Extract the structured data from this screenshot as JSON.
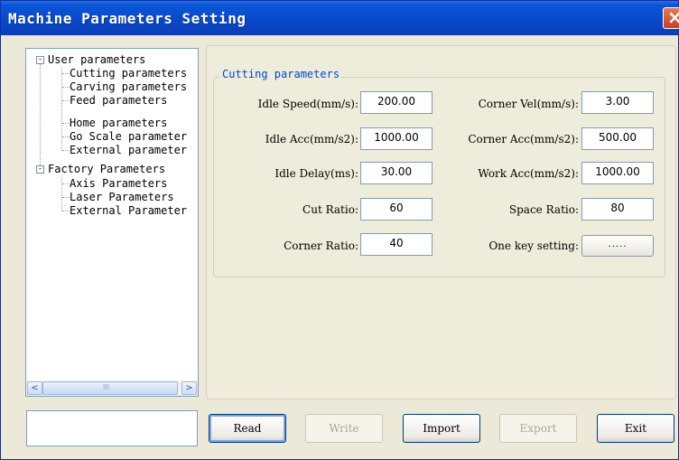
{
  "window": {
    "title": "Machine Parameters Setting"
  },
  "close_icon": "×",
  "tree": {
    "groups": [
      {
        "label": "User parameters",
        "children": [
          "Cutting parameters",
          "Carving parameters",
          "Feed parameters",
          "Home parameters",
          "Go Scale parameter",
          "External parameter"
        ]
      },
      {
        "label": "Factory Parameters",
        "children": [
          "Axis Parameters",
          "Laser Parameters",
          "External Parameter"
        ]
      }
    ]
  },
  "scrollbar": {
    "left_icon": "<",
    "right_icon": ">",
    "grip": "III"
  },
  "cutting": {
    "title": "Cutting parameters",
    "idle_speed": {
      "label": "Idle Speed(mm/s):",
      "value": "200.00"
    },
    "idle_acc": {
      "label": "Idle Acc(mm/s2):",
      "value": "1000.00"
    },
    "idle_delay": {
      "label": "Idle Delay(ms):",
      "value": "30.00"
    },
    "cut_ratio": {
      "label": "Cut Ratio:",
      "value": "60"
    },
    "corner_ratio": {
      "label": "Corner Ratio:",
      "value": "40"
    },
    "corner_vel": {
      "label": "Corner Vel(mm/s):",
      "value": "3.00"
    },
    "corner_acc": {
      "label": "Corner Acc(mm/s2):",
      "value": "500.00"
    },
    "work_acc": {
      "label": "Work Acc(mm/s2):",
      "value": "1000.00"
    },
    "space_ratio": {
      "label": "Space Ratio:",
      "value": "80"
    },
    "one_key": {
      "label": "One key setting:",
      "button": "....."
    }
  },
  "buttons": {
    "read": "Read",
    "write": "Write",
    "import": "Import",
    "export": "Export",
    "exit": "Exit"
  },
  "status": ""
}
